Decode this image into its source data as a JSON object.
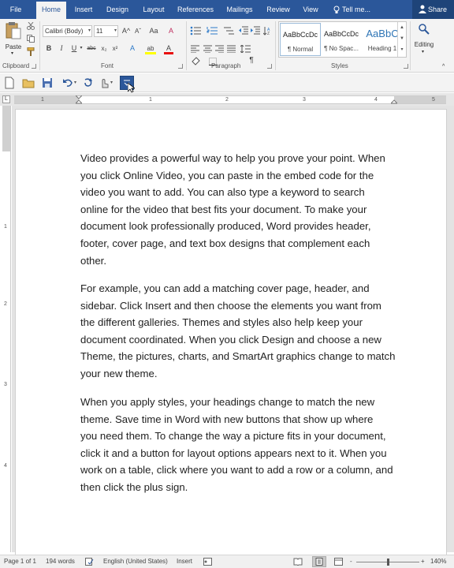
{
  "tabs": [
    {
      "label": "File",
      "active": false
    },
    {
      "label": "Home",
      "active": true
    },
    {
      "label": "Insert",
      "active": false
    },
    {
      "label": "Design",
      "active": false
    },
    {
      "label": "Layout",
      "active": false
    },
    {
      "label": "References",
      "active": false
    },
    {
      "label": "Mailings",
      "active": false
    },
    {
      "label": "Review",
      "active": false
    },
    {
      "label": "View",
      "active": false
    }
  ],
  "tell_me": "Tell me...",
  "share": "Share",
  "ribbon": {
    "clipboard": {
      "paste_label": "Paste",
      "group_label": "Clipboard"
    },
    "font": {
      "font_name": "Calibri (Body)",
      "font_size": "11",
      "group_label": "Font",
      "bold": "B",
      "italic": "I",
      "underline": "U",
      "strike": "abc",
      "subscript": "x₂",
      "superscript": "x²",
      "grow": "A^",
      "shrink": "Aˇ",
      "case": "Aa",
      "clear": "A",
      "effects": "A",
      "highlight": "ab",
      "color": "A"
    },
    "paragraph": {
      "group_label": "Paragraph",
      "pilcrow": "¶"
    },
    "styles": {
      "group_label": "Styles",
      "items": [
        {
          "sample": "AaBbCcDc",
          "name": "¶ Normal"
        },
        {
          "sample": "AaBbCcDc",
          "name": "¶ No Spac..."
        },
        {
          "sample": "AaBbC",
          "name": "Heading 1"
        }
      ]
    },
    "editing": {
      "label": "Editing"
    }
  },
  "accent_color": "#2b579a",
  "ruler": {
    "h_numbers": [
      "1",
      "1",
      "2",
      "3",
      "4",
      "5"
    ],
    "v_numbers": [
      "1",
      "2",
      "3",
      "4"
    ]
  },
  "document": {
    "paragraphs": [
      {
        "lines": [
          "Video provides a powerful way to help you prove your point. When",
          "you click Online Video, you can paste in the embed code for the",
          "video you want to add. You can also type a keyword to search",
          "online for the video that best fits your document. To make your",
          "document look professionally produced, Word provides header,",
          "footer, cover page, and text box designs that complement each",
          "other."
        ]
      },
      {
        "lines": [
          "For example, you can add a matching cover page, header, and",
          "sidebar. Click Insert and then choose the elements you want from",
          "the different galleries. Themes and styles also help keep your",
          "document coordinated. When you click Design and choose a new",
          "Theme, the pictures, charts, and SmartArt graphics change to match",
          "your new theme."
        ]
      },
      {
        "lines": [
          "When you apply styles, your headings change to match the new",
          "theme. Save time in Word with new buttons that show up where",
          "you need them. To change the way a picture fits in your document,",
          "click it and a button for layout options appears next to it. When you",
          "work on a table, click where you want to add a row or a column, and",
          "then click the plus sign."
        ]
      }
    ]
  },
  "status": {
    "page": "Page 1 of 1",
    "words": "194 words",
    "language": "English (United States)",
    "mode": "Insert",
    "zoom": "140%",
    "zoom_minus": "-",
    "zoom_plus": "+"
  }
}
